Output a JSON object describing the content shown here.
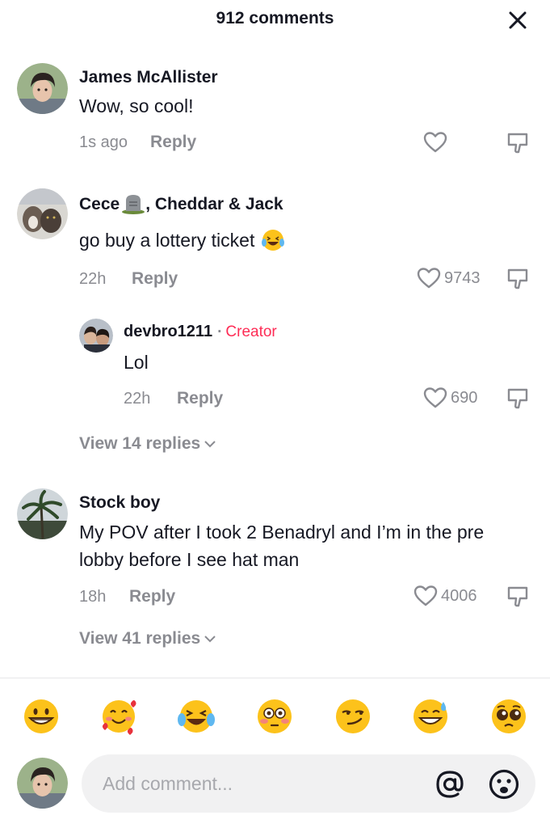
{
  "header": {
    "title": "912 comments",
    "close_icon": "close-icon"
  },
  "comments": [
    {
      "username": "James McAllister",
      "text": "Wow, so cool!",
      "time": "1s ago",
      "reply_label": "Reply",
      "likes": ""
    },
    {
      "username": "Cece",
      "username_emoji": "headstone-emoji",
      "username_rest": ", Cheddar & Jack",
      "text": "go buy a lottery ticket",
      "text_emoji": "laughing-tears-emoji",
      "time": "22h",
      "reply_label": "Reply",
      "likes": "9743",
      "replies": [
        {
          "username": "devbro1211",
          "badge_separator": "·",
          "badge": "Creator",
          "text": "Lol",
          "time": "22h",
          "reply_label": "Reply",
          "likes": "690"
        }
      ],
      "view_replies_label": "View 14 replies"
    },
    {
      "username": "Stock boy",
      "text": "My POV after I took 2 Benadryl and I’m in the pre lobby before I see hat man",
      "time": "18h",
      "reply_label": "Reply",
      "likes": "4006",
      "view_replies_label": "View 41 replies"
    }
  ],
  "quick_emojis": [
    "grinning-face",
    "smiling-face-with-hearts",
    "face-with-tears-of-joy",
    "flushed-face",
    "smirking-face",
    "grinning-face-with-sweat",
    "pleading-face"
  ],
  "composer": {
    "placeholder": "Add comment...",
    "mention_icon": "at-icon",
    "emoji_icon": "emoji-icon"
  },
  "colors": {
    "text": "#161823",
    "secondary": "#8a8b91",
    "creator": "#fe2c55",
    "input_bg": "#f1f1f2"
  }
}
